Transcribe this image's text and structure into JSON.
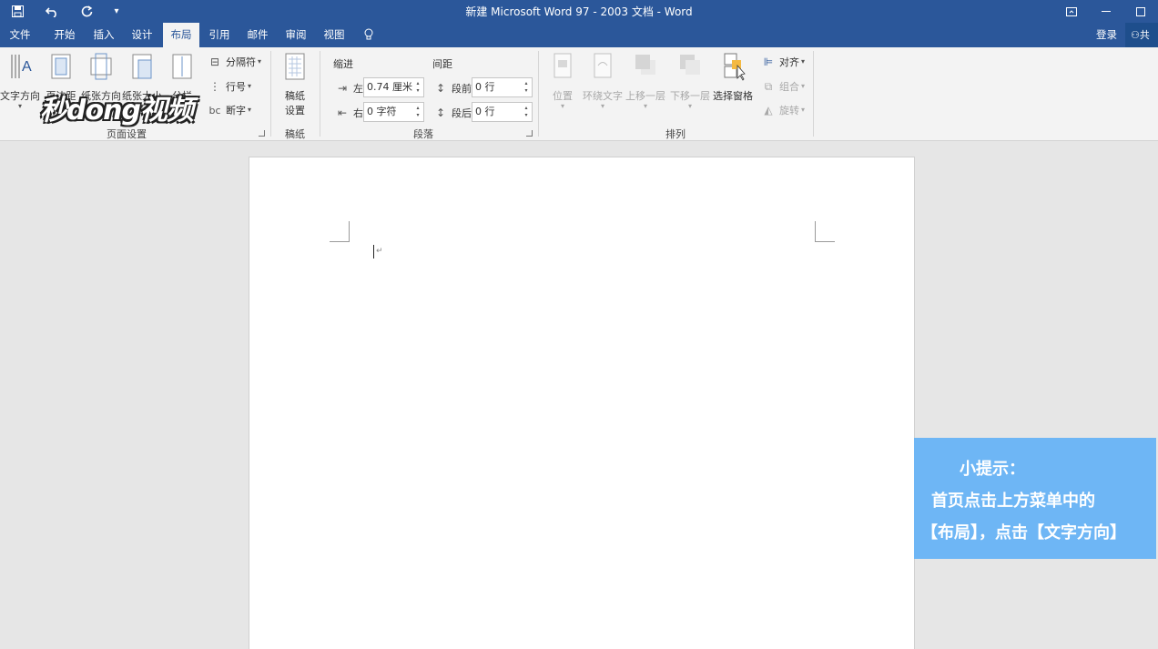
{
  "title_bar": {
    "title": "新建 Microsoft Word 97 - 2003 文档 - Word",
    "qat": {
      "save_icon": "save-icon",
      "undo_icon": "undo-icon",
      "redo_icon": "redo-icon",
      "customize_icon": "qat-dropdown-icon"
    },
    "window": {
      "restore_icon": "ribbon-display-icon",
      "minimize_icon": "minimize-icon",
      "maximize_icon": "maximize-icon"
    }
  },
  "tabs": [
    {
      "label": "文件"
    },
    {
      "label": "开始"
    },
    {
      "label": "插入"
    },
    {
      "label": "设计"
    },
    {
      "label": "布局",
      "active": true
    },
    {
      "label": "引用"
    },
    {
      "label": "邮件"
    },
    {
      "label": "审阅"
    },
    {
      "label": "视图"
    }
  ],
  "tell_me_icon": "lightbulb-icon",
  "account": {
    "login_label": "登录",
    "share_label": "共"
  },
  "ribbon": {
    "page_setup": {
      "label": "页面设置",
      "buttons": [
        {
          "label": "文字方向"
        },
        {
          "label": "页边距"
        },
        {
          "label": "纸张方向"
        },
        {
          "label": "纸张大小"
        },
        {
          "label": "分栏"
        }
      ],
      "small": [
        {
          "label": "分隔符"
        },
        {
          "label": "行号"
        },
        {
          "label": "断字"
        }
      ]
    },
    "draft": {
      "label": "稿纸",
      "button_line1": "稿纸",
      "button_line2": "设置"
    },
    "paragraph": {
      "label": "段落",
      "indent_heading": "缩进",
      "spacing_heading": "间距",
      "left_label": "左:",
      "left_value": "0.74 厘米",
      "right_label": "右:",
      "right_value": "0 字符",
      "before_label": "段前:",
      "before_value": "0 行",
      "after_label": "段后:",
      "after_value": "0 行"
    },
    "arrange": {
      "label": "排列",
      "buttons": [
        {
          "label": "位置"
        },
        {
          "label": "环绕文字"
        },
        {
          "label": "上移一层"
        },
        {
          "label": "下移一层"
        },
        {
          "label": "选择窗格"
        }
      ],
      "small": [
        {
          "label": "对齐"
        },
        {
          "label": "组合"
        },
        {
          "label": "旋转"
        }
      ]
    }
  },
  "document": {
    "paragraph_mark": "↵"
  },
  "watermark": {
    "text": "秒dong视频"
  },
  "tip": {
    "title": "小提示：",
    "line1": "首页点击上方菜单中的",
    "line2": "【布局】，点击【文字方向】"
  },
  "colors": {
    "accent": "#2b579a",
    "tip_bg": "#6eb6f5"
  }
}
